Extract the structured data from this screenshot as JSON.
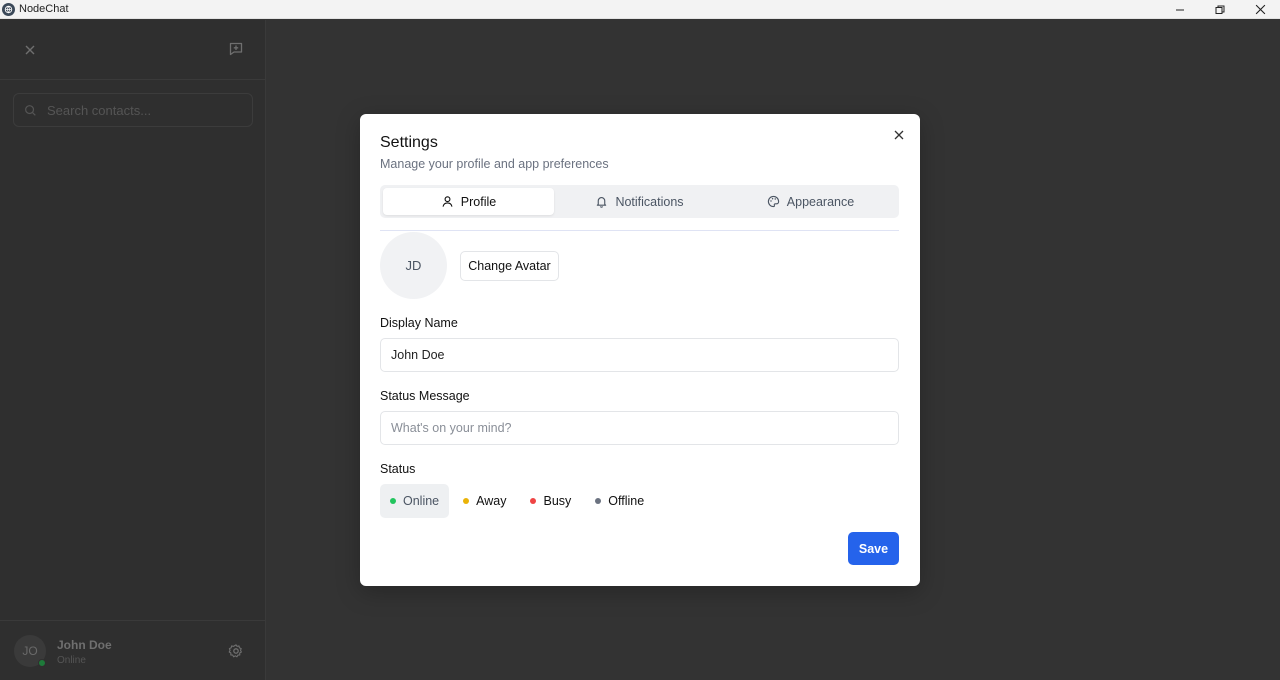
{
  "window": {
    "title": "NodeChat",
    "icon": "nodechat-logo-icon",
    "controls": [
      "minimize-icon",
      "restore-icon",
      "close-icon"
    ]
  },
  "sidebar": {
    "search_placeholder": "Search contacts...",
    "user": {
      "initials": "JO",
      "name": "John Doe",
      "status": "Online",
      "status_color": "#22c55e"
    }
  },
  "modal": {
    "title": "Settings",
    "subtitle": "Manage your profile and app preferences",
    "tabs": [
      {
        "label": "Profile",
        "icon": "user-icon",
        "active": true
      },
      {
        "label": "Notifications",
        "icon": "bell-icon",
        "active": false
      },
      {
        "label": "Appearance",
        "icon": "palette-icon",
        "active": false
      }
    ],
    "avatar_initials": "JD",
    "change_avatar_label": "Change Avatar",
    "display_name_label": "Display Name",
    "display_name_value": "John Doe",
    "status_message_label": "Status Message",
    "status_message_placeholder": "What's on your mind?",
    "status_label": "Status",
    "status_options": [
      {
        "label": "Online",
        "color": "#22c55e",
        "selected": true
      },
      {
        "label": "Away",
        "color": "#eab308",
        "selected": false
      },
      {
        "label": "Busy",
        "color": "#ef4444",
        "selected": false
      },
      {
        "label": "Offline",
        "color": "#6b7280",
        "selected": false
      }
    ],
    "save_label": "Save",
    "accent_color": "#2563eb"
  }
}
